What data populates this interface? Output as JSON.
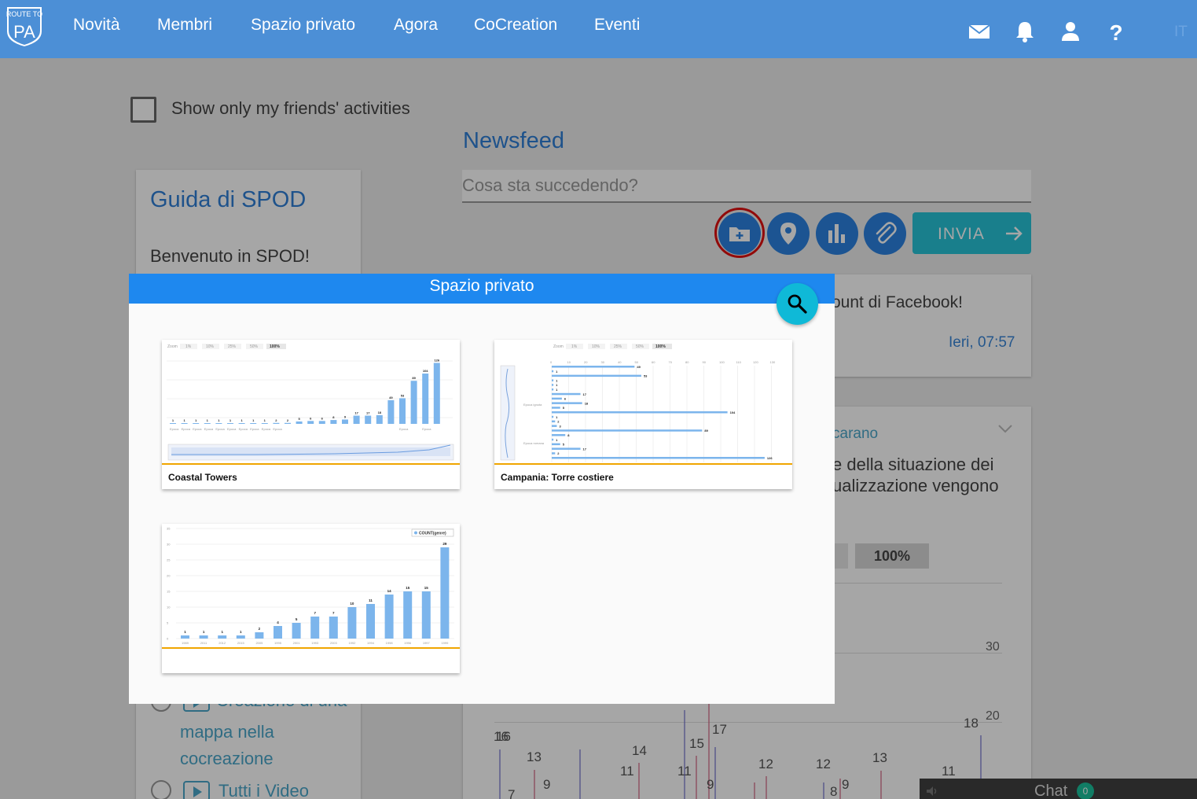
{
  "nav": {
    "logo_text_top": "ROUTE TO",
    "logo_text": "PA",
    "items": [
      "Novità",
      "Membri",
      "Spazio privato",
      "Agora",
      "CoCreation",
      "Eventi"
    ],
    "icons": [
      "mail-icon",
      "bell-icon",
      "user-icon",
      "help-icon"
    ],
    "language": "IT"
  },
  "filters": {
    "friends_only_label": "Show only my friends' activities"
  },
  "newsfeed": {
    "title": "Newsfeed",
    "placeholder": "Cosa sta succedendo?",
    "send_label": "INVIA",
    "action_icons": [
      "add-folder-icon",
      "location-pin-icon",
      "bar-chart-icon",
      "attachment-icon"
    ]
  },
  "guide": {
    "title": "Guida di SPOD",
    "welcome": "Benvenuto in SPOD!",
    "links": [
      "Creazione di una",
      "mappa nella",
      "cocreazione",
      "Tutti i Video"
    ]
  },
  "posts": [
    {
      "text": "ount di Facebook!",
      "time": "Ieri, 07:57"
    },
    {
      "link": "carano",
      "text_lines": [
        "e della situazione dei",
        "ualizzazione vengono"
      ],
      "zoom_label": "100%",
      "axis": [
        "30",
        "20"
      ]
    }
  ],
  "background_chart_labels": [
    "16",
    "16",
    "13",
    "9",
    "14",
    "11",
    "15",
    "11",
    "17",
    "9",
    "12",
    "12",
    "13",
    "18",
    "11",
    "8",
    "9",
    "7"
  ],
  "chat": {
    "label": "Chat",
    "count": "0"
  },
  "modal": {
    "title": "Spazio privato",
    "items": [
      {
        "label": "Coastal Towers",
        "zoom_options": [
          "Zoom",
          "1%",
          "10%",
          "25%",
          "50%",
          "100%"
        ],
        "values": [
          1,
          1,
          1,
          1,
          1,
          1,
          1,
          1,
          1,
          2,
          2,
          5,
          6,
          6,
          8,
          9,
          17,
          17,
          18,
          49,
          53,
          89,
          104,
          126
        ],
        "tick_labels": [
          "Epoca romana",
          "Epoca bizantina",
          "Epoca angioina",
          "Epoca bizantina",
          "Epoca sveva",
          "Epoca sveva",
          "Epoca romana",
          "Epoca bizantina",
          "Epoca ignota",
          "Epoca angioina",
          "Epoca normanna",
          "Epoca viceregnale"
        ]
      },
      {
        "label": "Campania: Torre costiere",
        "zoom_options": [
          "Zoom",
          "1%",
          "10%",
          "25%",
          "50%",
          "100%"
        ],
        "axis": [
          "0",
          "10",
          "20",
          "30",
          "40",
          "50",
          "60",
          "70",
          "80",
          "90",
          "100",
          "110",
          "120",
          "130"
        ],
        "values": [
          49,
          1,
          53,
          1,
          1,
          1,
          17,
          6,
          18,
          5,
          104,
          1,
          2,
          3,
          89,
          8,
          1,
          5,
          17,
          2,
          126
        ],
        "tick_labels": [
          "Epoca ignota",
          "Epoca romana"
        ]
      },
      {
        "label": "",
        "legend": "COUNT(genre)",
        "y_axis": [
          "35",
          "30",
          "25",
          "20",
          "15",
          "10",
          "5",
          "0"
        ],
        "categories": [
          "1989",
          "2011",
          "2012",
          "2015",
          "2005",
          "1995",
          "2001",
          "1993",
          "2003",
          "1992",
          "1994",
          "1998",
          "1996",
          "1997",
          "1999"
        ],
        "values": [
          1,
          1,
          1,
          1,
          2,
          4,
          5,
          7,
          7,
          10,
          11,
          14,
          15,
          15,
          29
        ]
      }
    ]
  },
  "colors": {
    "topbar": "#4c8fd6",
    "accent": "#2b82e0",
    "modal_header": "#1e88ef",
    "search": "#0fb9d7",
    "send": "#27c3d8",
    "bar": "#7cb5ec",
    "tile_underline": "#f0a500",
    "annotation_ring": "#e01010"
  }
}
